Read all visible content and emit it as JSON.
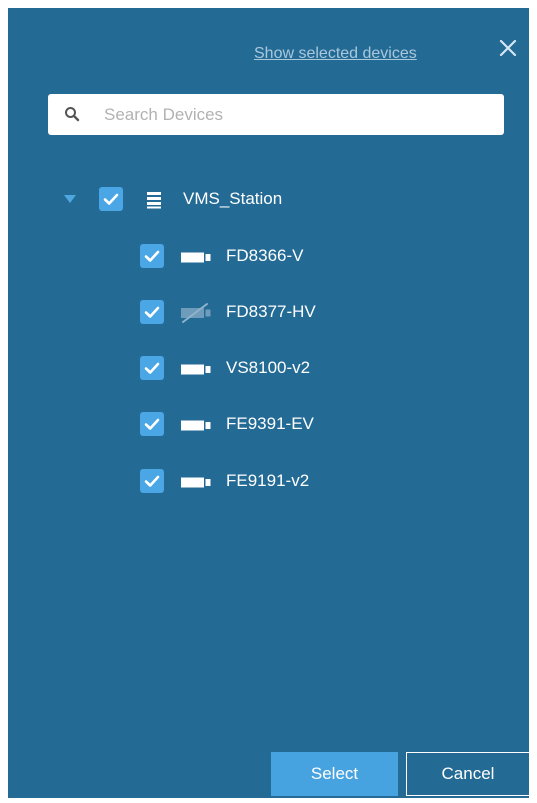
{
  "header": {
    "show_selected_label": "Show selected devices",
    "close_icon": "close-icon"
  },
  "search": {
    "placeholder": "Search Devices",
    "value": "",
    "icon": "search-icon"
  },
  "tree": {
    "root": {
      "label": "VMS_Station",
      "checked": true,
      "expanded": true,
      "icon": "server-icon"
    },
    "devices": [
      {
        "label": "FD8366-V",
        "checked": true,
        "icon": "camera-icon",
        "online": true
      },
      {
        "label": "FD8377-HV",
        "checked": true,
        "icon": "camera-disconnected-icon",
        "online": false
      },
      {
        "label": "VS8100-v2",
        "checked": true,
        "icon": "camera-icon",
        "online": true
      },
      {
        "label": "FE9391-EV",
        "checked": true,
        "icon": "camera-icon",
        "online": true
      },
      {
        "label": "FE9191-v2",
        "checked": true,
        "icon": "camera-icon",
        "online": true
      }
    ]
  },
  "footer": {
    "select_label": "Select",
    "cancel_label": "Cancel"
  },
  "colors": {
    "panel_bg": "#236a95",
    "accent": "#4aa6e5",
    "link": "#a9c8dc"
  }
}
